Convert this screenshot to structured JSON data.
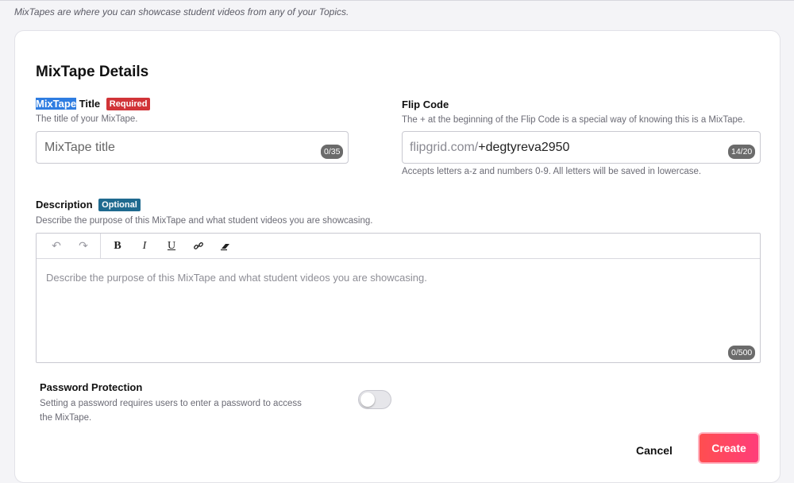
{
  "intro": "MixTapes are where you can showcase student videos from any of your Topics.",
  "section_title": "MixTape Details",
  "title_field": {
    "label_highlight": "MixTape",
    "label_rest": " Title",
    "badge": "Required",
    "help": "The title of your MixTape.",
    "placeholder": "MixTape title",
    "counter": "0/35"
  },
  "flip_code": {
    "label": "Flip Code",
    "help": "The + at the beginning of the Flip Code is a special way of knowing this is a MixTape.",
    "prefix": "flipgrid.com/",
    "value": "+degtyreva2950",
    "counter": "14/20",
    "note": "Accepts letters a-z and numbers 0-9. All letters will be saved in lowercase."
  },
  "description": {
    "label": "Description",
    "badge": "Optional",
    "help": "Describe the purpose of this MixTape and what student videos you are showcasing.",
    "placeholder": "Describe the purpose of this MixTape and what student videos you are showcasing.",
    "counter": "0/500",
    "toolbar": {
      "undo": "↶",
      "redo": "↷",
      "bold": "B",
      "italic": "I",
      "underline": "U",
      "link": "🔗",
      "clear": "⌫"
    }
  },
  "password": {
    "label": "Password Protection",
    "help_line1": "Setting a password requires users to enter a password to access",
    "help_line2": "the MixTape.",
    "enabled": false
  },
  "actions": {
    "cancel": "Cancel",
    "create": "Create"
  },
  "colors": {
    "required_badge": "#d13438",
    "optional_badge": "#1f6a8f",
    "create_gradient_start": "#ff4e50",
    "create_gradient_end": "#ff3d7a"
  }
}
